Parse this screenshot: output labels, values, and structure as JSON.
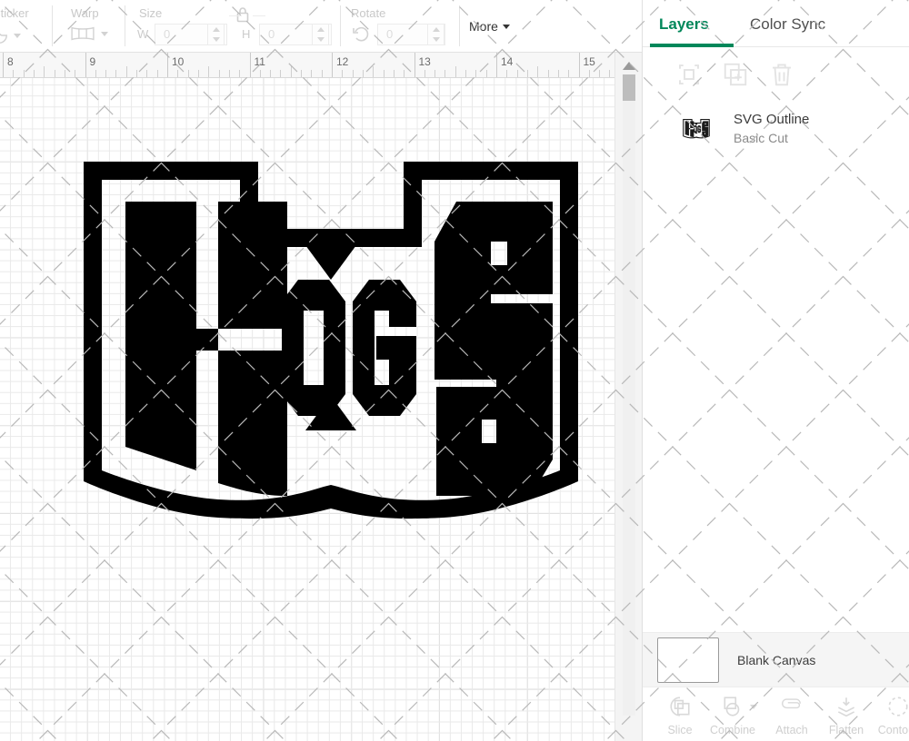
{
  "toolbar": {
    "groups": [
      {
        "caption": "Sticker",
        "icon": "sticker-icon"
      },
      {
        "caption": "Warp",
        "icon": "warp-icon"
      },
      {
        "caption": "Size",
        "icon": "lock-icon"
      },
      {
        "caption": "Rotate",
        "icon": "rotate-icon"
      }
    ],
    "size": {
      "caption": "Size",
      "width_label": "W",
      "width_value": "0",
      "height_label": "H",
      "height_value": "0",
      "lock_icon": "lock-closed-icon"
    },
    "rotate": {
      "caption": "Rotate",
      "value": "0",
      "icon": "rotate-icon"
    },
    "more_label": "More"
  },
  "ruler": {
    "unit_marks": [
      "8",
      "9",
      "10",
      "11",
      "12",
      "13",
      "14",
      "15"
    ]
  },
  "canvas": {
    "artwork_name": "HOGS",
    "artwork_color": "#000000",
    "grid_color": "#e9e9e9",
    "grid_major_color": "#cfcfcf",
    "scrollbar": {
      "orientation": "vertical",
      "position": "top"
    }
  },
  "panel": {
    "tabs": [
      {
        "label": "Layers",
        "active": true
      },
      {
        "label": "Color Sync",
        "active": false
      }
    ],
    "accent_color": "#00875a",
    "actions": [
      {
        "name": "group-icon",
        "enabled": false
      },
      {
        "name": "duplicate-icon",
        "enabled": false
      },
      {
        "name": "delete-icon",
        "enabled": false
      }
    ],
    "layers": [
      {
        "title": "SVG Outline",
        "subtitle": "Basic Cut",
        "thumbnail": "hogs-logo"
      }
    ],
    "canvas_row": {
      "label": "Blank Canvas",
      "swatch_color": "#ffffff"
    },
    "bottom_tools": [
      {
        "label": "Slice",
        "icon": "slice-icon",
        "has_caret": false
      },
      {
        "label": "Combine",
        "icon": "combine-icon",
        "has_caret": true
      },
      {
        "label": "Attach",
        "icon": "attach-icon",
        "has_caret": false
      },
      {
        "label": "Flatten",
        "icon": "flatten-icon",
        "has_caret": false
      },
      {
        "label": "Contour",
        "icon": "contour-icon",
        "has_caret": false
      }
    ]
  }
}
